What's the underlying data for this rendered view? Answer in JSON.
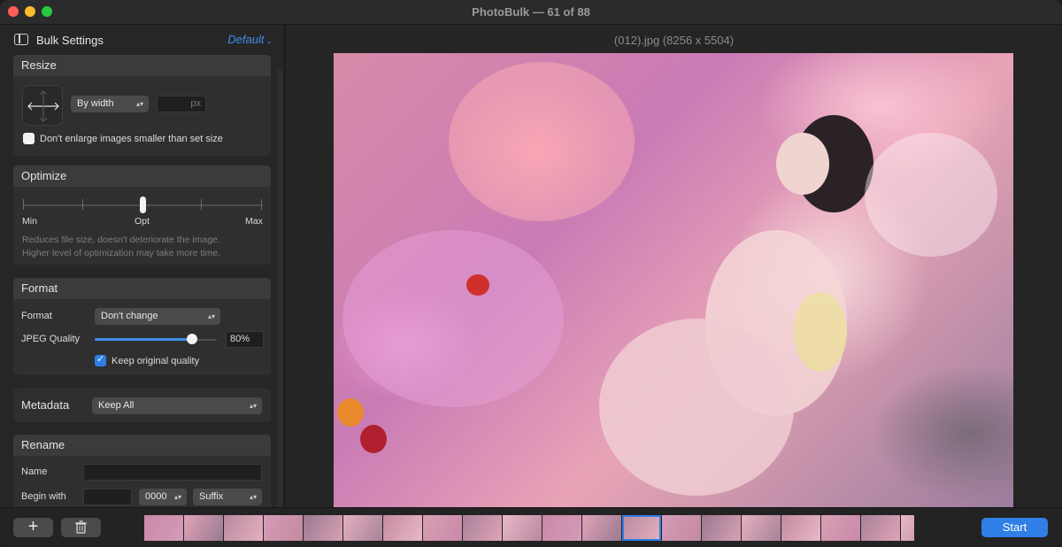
{
  "window": {
    "title": "PhotoBulk — 61 of 88"
  },
  "sidebar": {
    "title": "Bulk Settings",
    "preset": "Default",
    "resize": {
      "heading": "Resize",
      "mode": "By width",
      "size_value": "",
      "size_unit": "px",
      "no_enlarge_label": "Don't enlarge images smaller than set size",
      "no_enlarge_checked": false
    },
    "optimize": {
      "heading": "Optimize",
      "min_label": "Min",
      "opt_label": "Opt",
      "max_label": "Max",
      "level": 0.5,
      "desc_line1": "Reduces file size, doesn't deteriorate the image.",
      "desc_line2": "Higher level of optimization may take more time."
    },
    "format": {
      "heading": "Format",
      "format_label": "Format",
      "format_value": "Don't change",
      "quality_label": "JPEG Quality",
      "quality_value": "80%",
      "quality_fraction": 0.8,
      "keep_quality_label": "Keep original quality",
      "keep_quality_checked": true
    },
    "metadata": {
      "heading": "Metadata",
      "value": "Keep All"
    },
    "rename": {
      "heading": "Rename",
      "name_label": "Name",
      "name_value": "",
      "begin_label": "Begin with",
      "begin_value": "",
      "counter_value": "0000",
      "position_value": "Suffix"
    }
  },
  "main": {
    "filename": "(012).jpg (8256 x 5504)"
  },
  "bottom": {
    "add_label": "+",
    "start_label": "Start",
    "selected_thumb_index": 12
  },
  "colors": {
    "accent": "#2f7fe6",
    "link": "#3b8fe8",
    "background": "#232323"
  }
}
